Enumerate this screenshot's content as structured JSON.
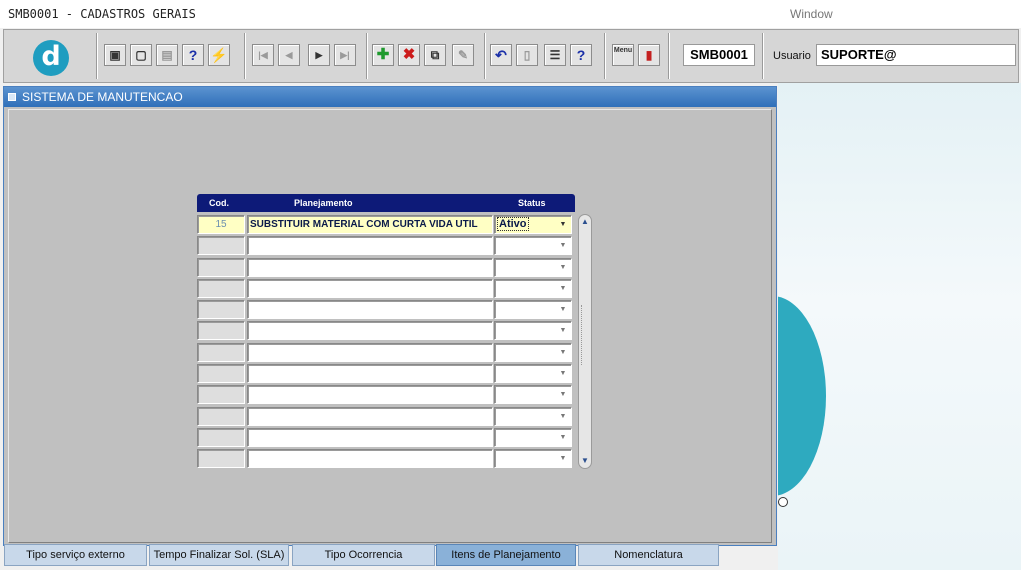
{
  "window": {
    "app_title": "SMB0001 - CADASTROS GERAIS",
    "menu_window": "Window"
  },
  "toolbar": {
    "logo_letter": "d",
    "form_code": "SMB0001",
    "user_label": "Usuario",
    "user_value": "SUPORTE@",
    "menu_glyph": "Menu",
    "icons": [
      "save-icon",
      "print-preview-icon",
      "print-icon",
      "query-icon",
      "execute-query-icon",
      "first-record-icon",
      "previous-record-icon",
      "next-record-icon",
      "last-record-icon",
      "insert-record-icon",
      "delete-record-icon",
      "duplicate-record-icon",
      "clear-icon",
      "undo-icon",
      "clipboard-icon",
      "list-values-icon",
      "help-icon",
      "menu-icon",
      "exit-icon"
    ]
  },
  "form": {
    "title": "SISTEMA DE MANUTENCAO",
    "columns": {
      "code": "Cod.",
      "plan": "Planejamento",
      "status": "Status"
    },
    "rows": [
      {
        "code": "15",
        "plan": "SUBSTITUIR MATERIAL COM CURTA VIDA UTIL",
        "status": "Ativo"
      },
      {
        "code": "",
        "plan": "",
        "status": ""
      },
      {
        "code": "",
        "plan": "",
        "status": ""
      },
      {
        "code": "",
        "plan": "",
        "status": ""
      },
      {
        "code": "",
        "plan": "",
        "status": ""
      },
      {
        "code": "",
        "plan": "",
        "status": ""
      },
      {
        "code": "",
        "plan": "",
        "status": ""
      },
      {
        "code": "",
        "plan": "",
        "status": ""
      },
      {
        "code": "",
        "plan": "",
        "status": ""
      },
      {
        "code": "",
        "plan": "",
        "status": ""
      },
      {
        "code": "",
        "plan": "",
        "status": ""
      },
      {
        "code": "",
        "plan": "",
        "status": ""
      }
    ]
  },
  "tabs": [
    {
      "label": "Tipo serviço externo",
      "selected": false
    },
    {
      "label": "Tempo Finalizar Sol. (SLA)",
      "selected": false
    },
    {
      "label": "Tipo Ocorrencia",
      "selected": false
    },
    {
      "label": "Itens de Planejamento",
      "selected": true
    },
    {
      "label": "Nomenclatura",
      "selected": false
    }
  ]
}
